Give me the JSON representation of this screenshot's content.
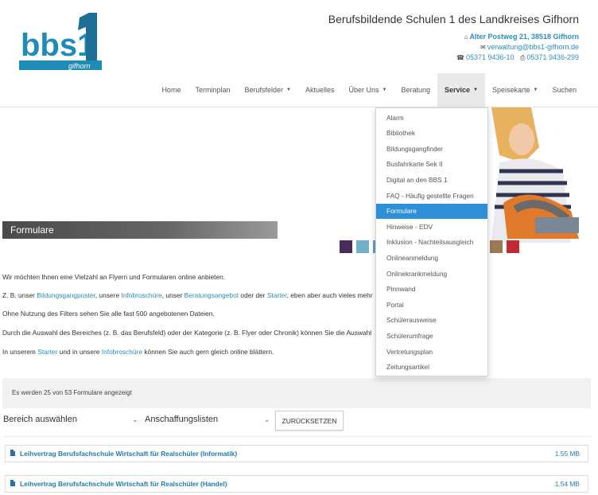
{
  "header": {
    "logo_text": "bbs1",
    "logo_sub": "gifhorn",
    "site_title": "Berufsbildende Schulen 1 des Landkreises Gifhorn",
    "address": "Alter Postweg 21, 38518 Gifhorn",
    "email": "verwaltung@bbs1-gifhorn.de",
    "phone": "05371 9436-10",
    "fax": "05371 9436-299"
  },
  "nav": {
    "items": [
      {
        "label": "Home"
      },
      {
        "label": "Terminplan"
      },
      {
        "label": "Berufsfelder"
      },
      {
        "label": "Aktuelles"
      },
      {
        "label": "Über Uns"
      },
      {
        "label": "Beratung"
      },
      {
        "label": "Service"
      },
      {
        "label": "Speisekarte"
      },
      {
        "label": "Suchen"
      }
    ]
  },
  "dropdown": {
    "items": [
      "Alarm",
      "Bibliothek",
      "Bildungsgangfinder",
      "Busfahrkarte Sek II",
      "Digital an den BBS 1",
      "FAQ - Häufig gestellte Fragen",
      "Formulare",
      "Hinweise - EDV",
      "Inklusion - Nachteilsausgleich",
      "Onlineanmeldung",
      "Onlinekrankmeldung",
      "Pinnwand",
      "Portal",
      "Schülerausweise",
      "Schülerumfrage",
      "Vertretungsplan",
      "Zeitungsartikel"
    ],
    "active": "Formulare"
  },
  "hero": {
    "title": "Formulare",
    "swatch_colors": [
      "#4b2a5c",
      "#6fb2c9",
      "#5aa3cf",
      "#3c8a46",
      "#b9b9b9",
      "#6a9b3a",
      "#3e6aa6",
      "#8a4f92",
      "#e67b2e",
      "#9b7b56",
      "#c02a30"
    ]
  },
  "content": {
    "intro": "Wir möchten Ihnen eine Vielzahl an Flyern und Formularen online anbieten.",
    "line2": {
      "a": "Z. B. unser ",
      "link1": "Bildungsgangposter",
      "b": ", unsere ",
      "link2": "Infobroschüre",
      "c": ", unser ",
      "link3": "Beratungsangebot",
      "d": " oder der ",
      "link4": "Starter",
      "e": ", eben aber auch vieles mehr"
    },
    "line3": "Ohne Nutzung des Filters sehen Sie alle fast 500 angebotenen Dateien.",
    "line4": "Durch die Auswahl des Bereiches (z. B. das Berufsfeld) oder der Kategorie (z. B. Flyer oder Chronik) können Sie die Auswahl",
    "line5": {
      "a": "In unserem ",
      "link1": "Starter",
      "b": " und in unsere ",
      "link2": "Infobroschüre",
      "c": " können Sie auch gern gleich online blättern."
    }
  },
  "filter": {
    "count_text": "Es werden 25 von 53 Formulare angezeigt",
    "bereich": "Bereich auswählen",
    "kategorie": "Anschaffungslisten",
    "reset_label": "ZURÜCKSETZEN"
  },
  "files": [
    {
      "name": "Leihvertrag Berufsfachschule Wirtschaft für Realschüler (Informatik)",
      "size": "1.55 MB"
    },
    {
      "name": "Leihvertrag Berufsfachschule Wirtschaft für Realschüler (Handel)",
      "size": "1.54 MB"
    }
  ]
}
